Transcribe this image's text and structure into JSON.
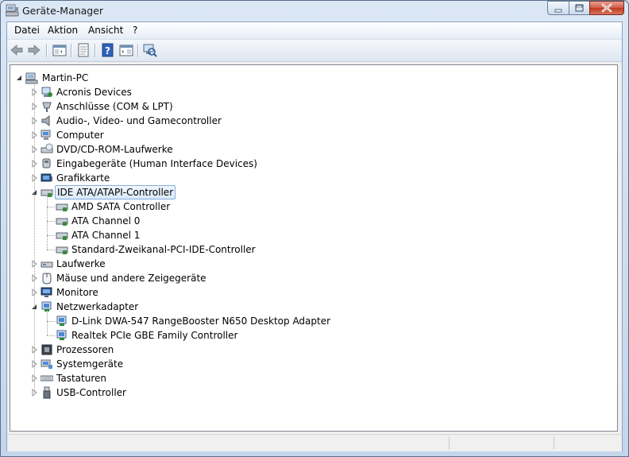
{
  "window": {
    "title": "Geräte-Manager"
  },
  "menu": [
    "Datei",
    "Aktion",
    "Ansicht",
    "?"
  ],
  "toolbar": [
    {
      "name": "back-icon"
    },
    {
      "name": "forward-icon"
    },
    {
      "name": "show-hide-console-tree-icon"
    },
    {
      "name": "properties-icon"
    },
    {
      "name": "help-icon"
    },
    {
      "name": "show-action-pane-icon"
    },
    {
      "name": "scan-hardware-changes-icon"
    }
  ],
  "tree": {
    "root": "Martin-PC",
    "categories": [
      {
        "label": "Acronis Devices",
        "icon": "acronis-device-icon",
        "expanded": false
      },
      {
        "label": "Anschlüsse (COM & LPT)",
        "icon": "port-icon",
        "expanded": false
      },
      {
        "label": "Audio-, Video- und Gamecontroller",
        "icon": "speaker-icon",
        "expanded": false
      },
      {
        "label": "Computer",
        "icon": "computer-icon",
        "expanded": false
      },
      {
        "label": "DVD/CD-ROM-Laufwerke",
        "icon": "dvd-drive-icon",
        "expanded": false
      },
      {
        "label": "Eingabegeräte (Human Interface Devices)",
        "icon": "hid-icon",
        "expanded": false
      },
      {
        "label": "Grafikkarte",
        "icon": "display-adapter-icon",
        "expanded": false
      },
      {
        "label": "IDE ATA/ATAPI-Controller",
        "icon": "ide-controller-icon",
        "expanded": true,
        "selected": true,
        "children": [
          "AMD SATA Controller",
          "ATA Channel 0",
          "ATA Channel 1",
          "Standard-Zweikanal-PCI-IDE-Controller"
        ]
      },
      {
        "label": "Laufwerke",
        "icon": "disk-drive-icon",
        "expanded": false
      },
      {
        "label": "Mäuse und andere Zeigegeräte",
        "icon": "mouse-icon",
        "expanded": false
      },
      {
        "label": "Monitore",
        "icon": "monitor-icon",
        "expanded": false
      },
      {
        "label": "Netzwerkadapter",
        "icon": "network-adapter-icon",
        "expanded": true,
        "children": [
          "D-Link DWA-547 RangeBooster N650 Desktop Adapter",
          "Realtek PCIe GBE Family Controller"
        ]
      },
      {
        "label": "Prozessoren",
        "icon": "processor-icon",
        "expanded": false
      },
      {
        "label": "Systemgeräte",
        "icon": "system-device-icon",
        "expanded": false
      },
      {
        "label": "Tastaturen",
        "icon": "keyboard-icon",
        "expanded": false
      },
      {
        "label": "USB-Controller",
        "icon": "usb-icon",
        "expanded": false
      }
    ]
  },
  "colors": {
    "selection_border": "#84acdd",
    "selection_fill": "#dbe9f9",
    "close_button": "#c0391f"
  }
}
